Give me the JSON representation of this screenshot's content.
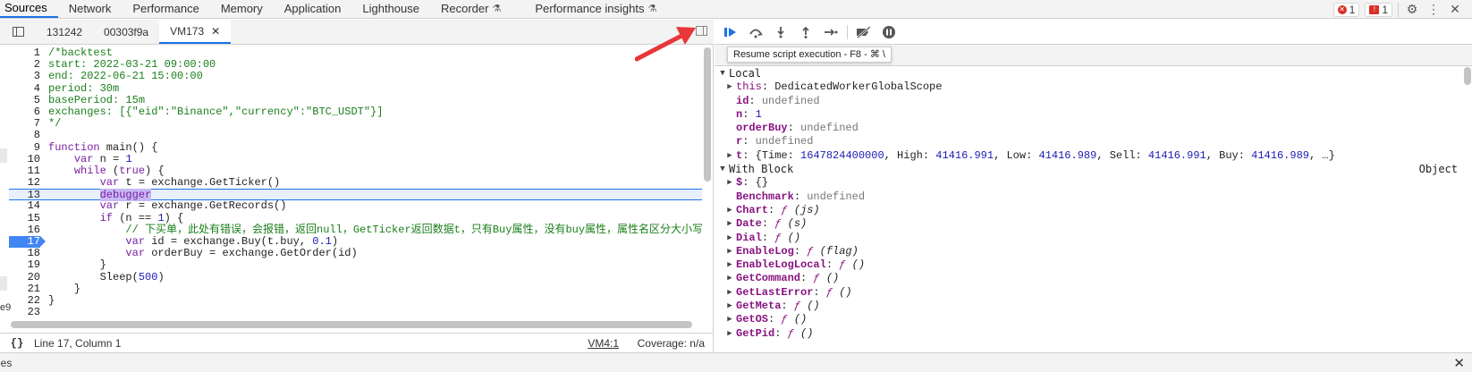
{
  "top_tabs": [
    {
      "label": "Sources",
      "active": true
    },
    {
      "label": "Network"
    },
    {
      "label": "Performance"
    },
    {
      "label": "Memory"
    },
    {
      "label": "Application"
    },
    {
      "label": "Lighthouse"
    },
    {
      "label": "Recorder",
      "flask": true
    },
    {
      "label": "Performance insights",
      "flask": true
    }
  ],
  "badges": {
    "errors": "1",
    "warnings": "1"
  },
  "file_tabs": [
    {
      "label": "131242"
    },
    {
      "label": "00303f9a"
    },
    {
      "label": "VM173",
      "active": true
    }
  ],
  "code_lines": [
    {
      "n": "1",
      "html": "<span class='c-comment'>/*backtest</span>"
    },
    {
      "n": "2",
      "html": "<span class='c-comment'>start: 2022-03-21 09:00:00</span>"
    },
    {
      "n": "3",
      "html": "<span class='c-comment'>end: 2022-06-21 15:00:00</span>"
    },
    {
      "n": "4",
      "html": "<span class='c-comment'>period: 30m</span>"
    },
    {
      "n": "5",
      "html": "<span class='c-comment'>basePeriod: 15m</span>"
    },
    {
      "n": "6",
      "html": "<span class='c-comment'>exchanges: [{\"eid\":\"Binance\",\"currency\":\"BTC_USDT\"}]</span>"
    },
    {
      "n": "7",
      "html": "<span class='c-comment'>*/</span>"
    },
    {
      "n": "8",
      "html": ""
    },
    {
      "n": "9",
      "html": "<span class='c-kw'>function</span> main() {"
    },
    {
      "n": "10",
      "html": "    <span class='c-kw'>var</span> n = <span class='c-num'>1</span>"
    },
    {
      "n": "11",
      "html": "    <span class='c-kw'>while</span> (<span class='c-kw'>true</span>) {"
    },
    {
      "n": "12",
      "html": "        <span class='c-kw'>var</span> t = exchange.GetTicker()"
    },
    {
      "n": "13",
      "html": "        <span class='c-debugger'>debugger</span>",
      "highlight": true
    },
    {
      "n": "14",
      "html": "        <span class='c-kw'>var</span> r = exchange.GetRecords()"
    },
    {
      "n": "15",
      "html": "        <span class='c-kw'>if</span> (n == <span class='c-num'>1</span>) {"
    },
    {
      "n": "16",
      "html": "            <span class='c-comment'>// 下买单，此处有错误，会报错，返回null，GetTicker返回数据t，只有Buy属性，没有buy属性，属性名区分大小写</span>"
    },
    {
      "n": "17",
      "html": "            <span class='c-kw'>var</span> id = exchange.Buy(t.buy, <span class='c-num'>0.1</span>)",
      "breakpoint": true
    },
    {
      "n": "18",
      "html": "            <span class='c-kw'>var</span> orderBuy = exchange.GetOrder(id)"
    },
    {
      "n": "19",
      "html": "        }"
    },
    {
      "n": "20",
      "html": "        Sleep(<span class='c-num'>500</span>)"
    },
    {
      "n": "21",
      "html": "    }"
    },
    {
      "n": "22",
      "html": "}"
    },
    {
      "n": "23",
      "html": ""
    }
  ],
  "status": {
    "braces": "{}",
    "position": "Line 17, Column 1",
    "vm_link": "VM4:1",
    "coverage": "Coverage: n/a"
  },
  "tooltip": "Resume script execution - F8 - ⌘ \\",
  "scope": {
    "local_label": "Local",
    "local": [
      {
        "key": "this",
        "value": "DedicatedWorkerGlobalScope",
        "expandable": true,
        "bold": false,
        "vclass": "v-plain"
      },
      {
        "key": "id",
        "value": "undefined",
        "bold": true,
        "vclass": "v-undef"
      },
      {
        "key": "n",
        "value": "1",
        "bold": true,
        "vclass": "v-num"
      },
      {
        "key": "orderBuy",
        "value": "undefined",
        "bold": true,
        "vclass": "v-undef"
      },
      {
        "key": "r",
        "value": "undefined",
        "bold": true,
        "vclass": "v-undef"
      },
      {
        "key": "t",
        "value": "{Time: 1647824400000, High: 41416.991, Low: 41416.989, Sell: 41416.991, Buy: 41416.989, …}",
        "expandable": true,
        "bold": true,
        "vclass": "v-obj"
      }
    ],
    "with_label": "With Block",
    "with_right": "Object",
    "with": [
      {
        "key": "$",
        "value": "{}",
        "expandable": true,
        "bold": true,
        "vclass": "v-plain"
      },
      {
        "key": "Benchmark",
        "value": "undefined",
        "bold": true,
        "vclass": "v-undef"
      },
      {
        "key": "Chart",
        "value": "ƒ (js)",
        "expandable": true,
        "bold": true,
        "vclass": "v-fn"
      },
      {
        "key": "Date",
        "value": "ƒ (s)",
        "expandable": true,
        "bold": true,
        "vclass": "v-fn"
      },
      {
        "key": "Dial",
        "value": "ƒ ()",
        "expandable": true,
        "bold": true,
        "vclass": "v-fn"
      },
      {
        "key": "EnableLog",
        "value": "ƒ (flag)",
        "expandable": true,
        "bold": true,
        "vclass": "v-fn"
      },
      {
        "key": "EnableLogLocal",
        "value": "ƒ ()",
        "expandable": true,
        "bold": true,
        "vclass": "v-fn"
      },
      {
        "key": "GetCommand",
        "value": "ƒ ()",
        "expandable": true,
        "bold": true,
        "vclass": "v-fn"
      },
      {
        "key": "GetLastError",
        "value": "ƒ ()",
        "expandable": true,
        "bold": true,
        "vclass": "v-fn"
      },
      {
        "key": "GetMeta",
        "value": "ƒ ()",
        "expandable": true,
        "bold": true,
        "vclass": "v-fn"
      },
      {
        "key": "GetOS",
        "value": "ƒ ()",
        "expandable": true,
        "bold": true,
        "vclass": "v-fn"
      },
      {
        "key": "GetPid",
        "value": "ƒ ()",
        "expandable": true,
        "bold": true,
        "vclass": "v-fn"
      }
    ]
  },
  "drawer_label": "ies",
  "edge_text": "e9",
  "colors": {
    "accent": "#1a73e8",
    "breakpoint": "#4285f4",
    "arrow": "#e8363a"
  }
}
